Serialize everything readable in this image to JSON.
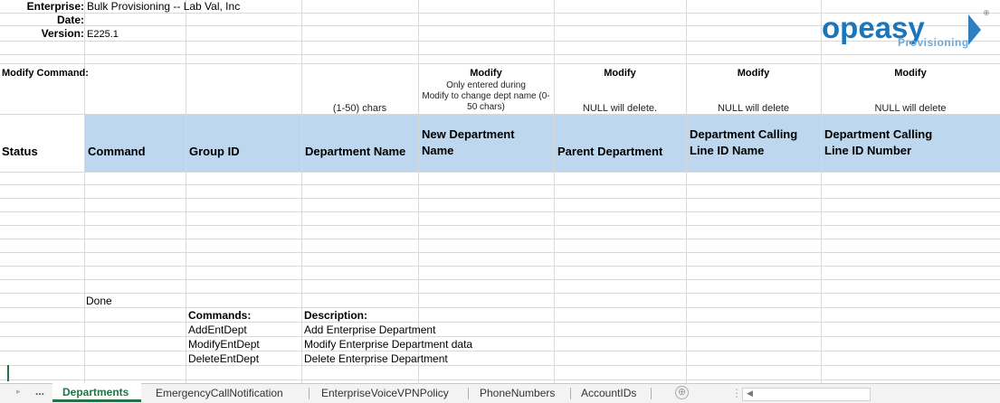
{
  "header": {
    "enterprise_label": "Enterprise:",
    "enterprise_value": "Bulk Provisioning -- Lab Val, Inc",
    "date_label": "Date:",
    "version_label": "Version:",
    "version_value": "E225.1"
  },
  "logo": {
    "brand": "opeasy",
    "sub": "Provisioning",
    "reg": "®",
    "chevron_color": "#2e7fc1",
    "brand_color": "#1a75bb"
  },
  "modify_row": {
    "label": "Modify Command:",
    "cols": [
      "Modify",
      "Modify",
      "Modify",
      "Modify"
    ]
  },
  "notes": {
    "dept_name": "(1-50) chars",
    "new_dept_name_lines": [
      "Only entered during",
      "Modify to change dept name (0-",
      "50 chars)"
    ],
    "parent_dept": "NULL will delete.",
    "calling_name": "NULL will delete",
    "calling_number": "NULL will delete"
  },
  "columns": {
    "status": "Status",
    "command": "Command",
    "group_id": "Group ID",
    "department_name": "Department Name",
    "new_department_name_1": "New Department",
    "new_department_name_2": "Name",
    "parent_department": "Parent Department",
    "calling_name_1": "Department Calling",
    "calling_name_2": "Line ID Name",
    "calling_number_1": "Department Calling",
    "calling_number_2": " Line ID Number"
  },
  "done": "Done",
  "commands_table": {
    "header_command": "Commands:",
    "header_description": "Description:",
    "rows": [
      {
        "command": "AddEntDept",
        "description": "Add Enterprise Department"
      },
      {
        "command": "ModifyEntDept",
        "description": "Modify Enterprise Department data"
      },
      {
        "command": "DeleteEntDept",
        "description": "Delete Enterprise Department"
      }
    ]
  },
  "tabs": {
    "nav_more": "...",
    "active": "Departments",
    "others": [
      "EmergencyCallNotification",
      "EnterpriseVoiceVPNPolicy",
      "PhoneNumbers",
      "AccountIDs"
    ],
    "add_icon": "⊕",
    "accent": "#217346"
  }
}
